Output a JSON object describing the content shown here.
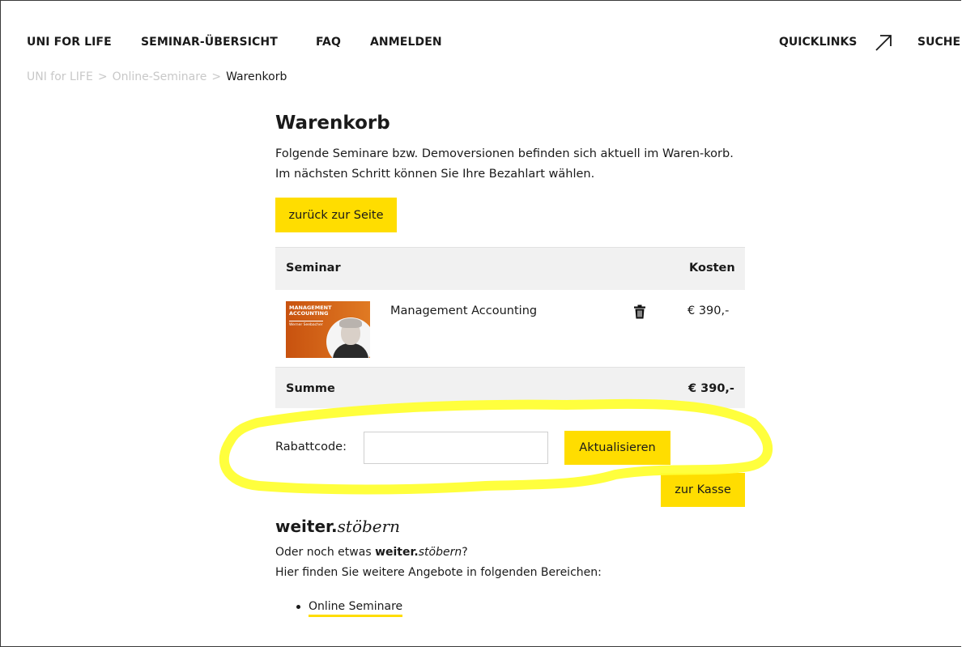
{
  "nav": {
    "items": [
      "UNI FOR LIFE",
      "SEMINAR-ÜBERSICHT",
      "FAQ",
      "ANMELDEN"
    ],
    "quicklinks": "QUICKLINKS",
    "search": "SUCHE"
  },
  "breadcrumb": {
    "items": [
      "UNI for LIFE",
      "Online-Seminare",
      "Warenkorb"
    ],
    "separator": ">"
  },
  "cart": {
    "title": "Warenkorb",
    "intro": "Folgende Seminare bzw. Demoversionen befinden sich aktuell im Waren-korb. Im nächsten Schritt können Sie Ihre Bezahlart wählen.",
    "back_button": "zurück zur Seite",
    "col_seminar": "Seminar",
    "col_cost": "Kosten",
    "items": [
      {
        "title": "Management Accounting",
        "price": "€ 390,-",
        "thumb_title": "MANAGEMENT ACCOUNTING",
        "thumb_author": "Werner Seebacher"
      }
    ],
    "sum_label": "Summe",
    "sum_value": "€ 390,-",
    "discount_label": "Rabattcode:",
    "discount_value": "",
    "update_button": "Aktualisieren",
    "checkout_button": "zur Kasse"
  },
  "browse": {
    "heading_bold": "weiter.",
    "heading_italic": "stöbern",
    "line1_prefix": "Oder noch etwas ",
    "line1_bold": "weiter.",
    "line1_italic": "stöbern",
    "line1_suffix": "?",
    "line2": "Hier finden Sie weitere Angebote in folgenden Bereichen:",
    "links": [
      "Online Seminare"
    ]
  },
  "colors": {
    "accent": "#ffdd00",
    "highlight_marker": "#ffff33",
    "table_bg": "#f1f1f1"
  }
}
